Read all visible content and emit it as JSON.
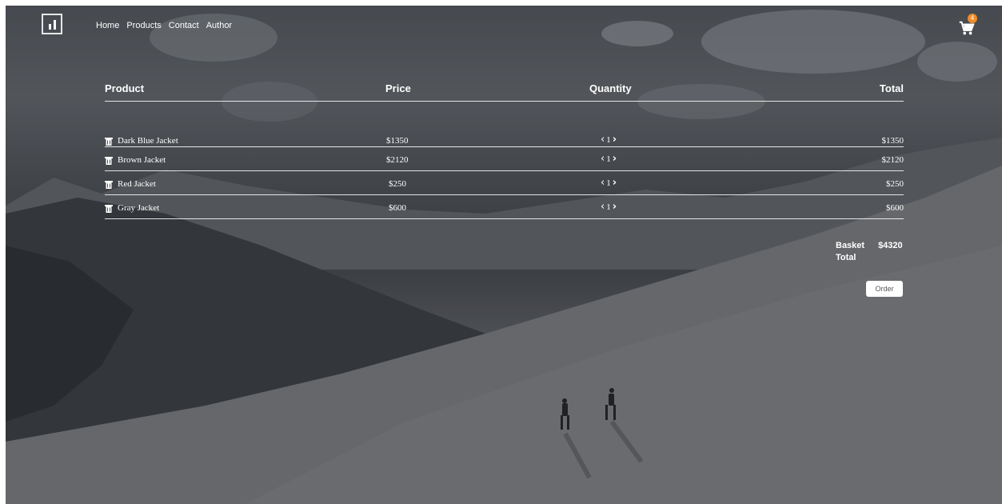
{
  "header": {
    "nav": [
      "Home",
      "Products",
      "Contact",
      "Author"
    ],
    "cart_count": "4"
  },
  "table": {
    "headers": {
      "product": "Product",
      "price": "Price",
      "quantity": "Quantity",
      "total": "Total"
    },
    "rows": [
      {
        "name": "Dark Blue Jacket",
        "price": "$1350",
        "qty": "1",
        "total": "$1350"
      },
      {
        "name": "Brown Jacket",
        "price": "$2120",
        "qty": "1",
        "total": "$2120"
      },
      {
        "name": "Red Jacket",
        "price": "$250",
        "qty": "1",
        "total": "$250"
      },
      {
        "name": "Gray Jacket",
        "price": "$600",
        "qty": "1",
        "total": "$600"
      }
    ]
  },
  "summary": {
    "label": "Basket Total",
    "value": "$4320"
  },
  "order_label": "Order",
  "colors": {
    "badge": "#f08c28",
    "text": "#ffffff"
  }
}
